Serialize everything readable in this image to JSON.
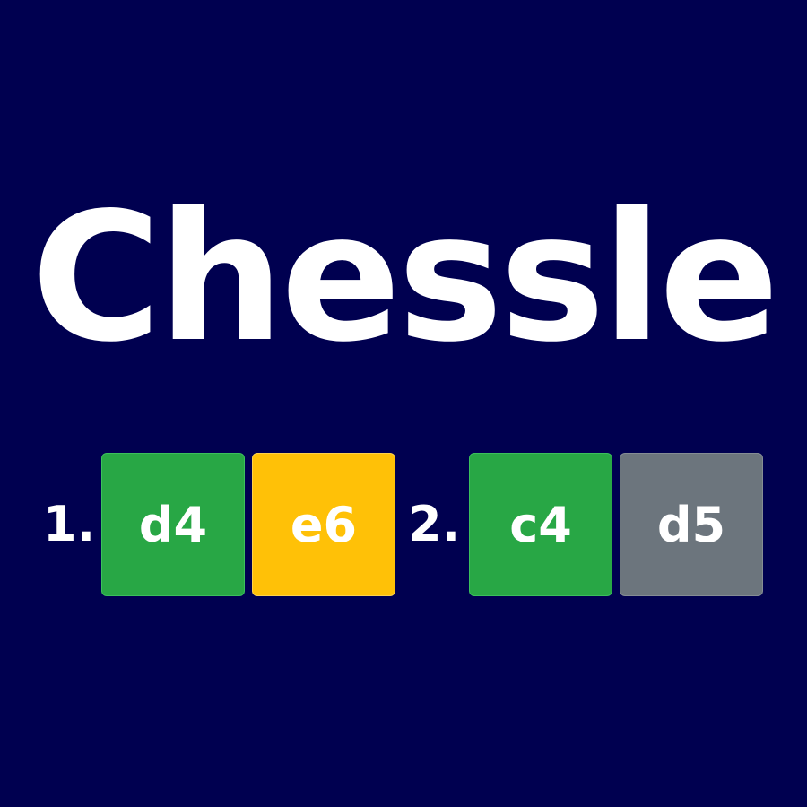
{
  "title": "Chessle",
  "colors": {
    "background": "#000050",
    "correct": "#28a745",
    "present": "#ffc107",
    "absent": "#6c757d",
    "text": "#ffffff"
  },
  "moves": [
    {
      "number": "1.",
      "white": {
        "move": "d4",
        "status": "correct"
      },
      "black": {
        "move": "e6",
        "status": "present"
      }
    },
    {
      "number": "2.",
      "white": {
        "move": "c4",
        "status": "correct"
      },
      "black": {
        "move": "d5",
        "status": "absent"
      }
    }
  ]
}
